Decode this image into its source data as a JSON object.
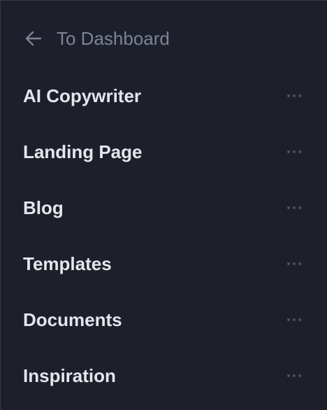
{
  "back": {
    "label": "To Dashboard",
    "icon": "arrow-left-icon"
  },
  "nav": {
    "items": [
      {
        "label": "AI Copywriter",
        "more_icon": "more-horizontal-icon"
      },
      {
        "label": "Landing Page",
        "more_icon": "more-horizontal-icon"
      },
      {
        "label": "Blog",
        "more_icon": "more-horizontal-icon"
      },
      {
        "label": "Templates",
        "more_icon": "more-horizontal-icon"
      },
      {
        "label": "Documents",
        "more_icon": "more-horizontal-icon"
      },
      {
        "label": "Inspiration",
        "more_icon": "more-horizontal-icon"
      }
    ]
  },
  "colors": {
    "background": "#1d202a",
    "border": "#363a47",
    "muted_text": "#7c8496",
    "primary_text": "#e4e6eb",
    "dots": "#4a4f5c"
  }
}
